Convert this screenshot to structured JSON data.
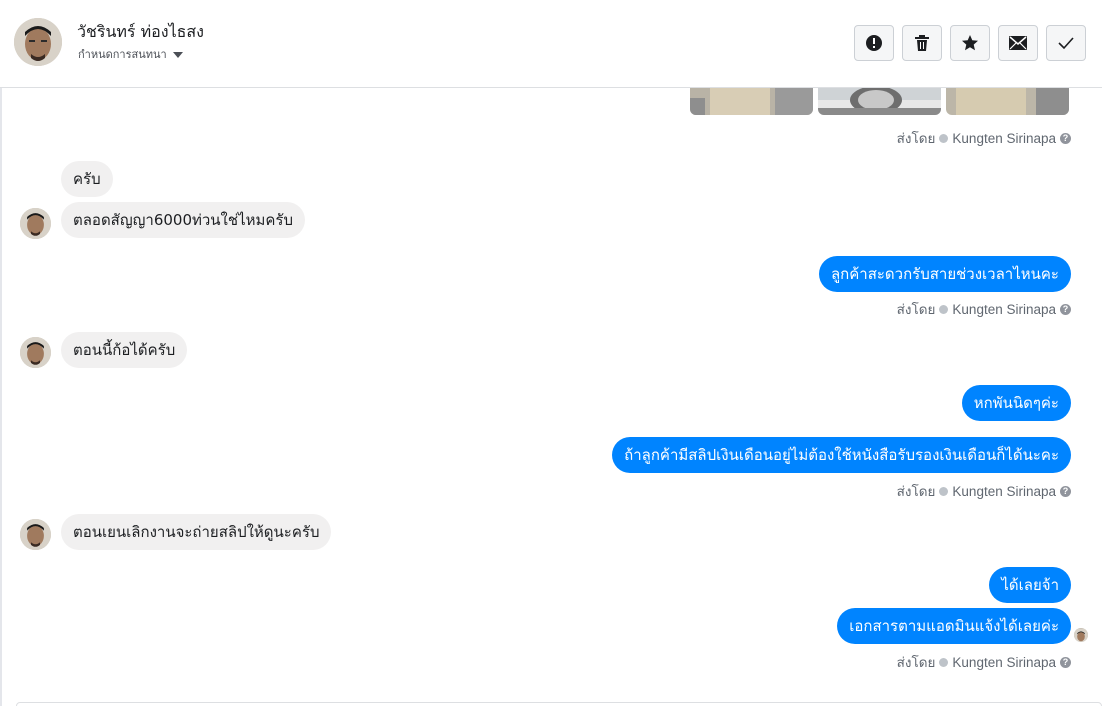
{
  "header": {
    "contact_name": "วัชรินทร์ ท่องไธสง",
    "subtitle": "กำหนดการสนทนา",
    "actions": [
      {
        "icon": "alert-icon"
      },
      {
        "icon": "trash-icon"
      },
      {
        "icon": "star-icon"
      },
      {
        "icon": "envelope-icon"
      },
      {
        "icon": "check-icon"
      }
    ]
  },
  "sent_by": {
    "prefix": "ส่งโดย",
    "name": "Kungten Sirinapa",
    "help": "?"
  },
  "messages": {
    "in_1": "ครับ",
    "in_2": "ตลอดสัญญา6000ท่วนใช่ไหมครับ",
    "out_1": "ลูกค้าสะดวกรับสายช่วงเวลาไหนคะ",
    "in_3": "ตอนนี้ก้อได้ครับ",
    "out_2": "หกพันนิดๆค่ะ",
    "out_3": "ถ้าลูกค้ามีสลิปเงินเดือนอยู่ไม่ต้องใช้หนังสือรับรองเงินเดือนก็ได้นะคะ",
    "in_4": "ตอนเยนเลิกงานจะถ่ายสลิปให้ดูนะครับ",
    "out_4": "ได้เลยจ้า",
    "out_5": "เอกสารตามแอดมินแจ้งได้เลยค่ะ"
  },
  "colors": {
    "outgoing_bubble": "#0084ff",
    "incoming_bubble": "#f1f0f0",
    "meta_text": "#606770"
  }
}
